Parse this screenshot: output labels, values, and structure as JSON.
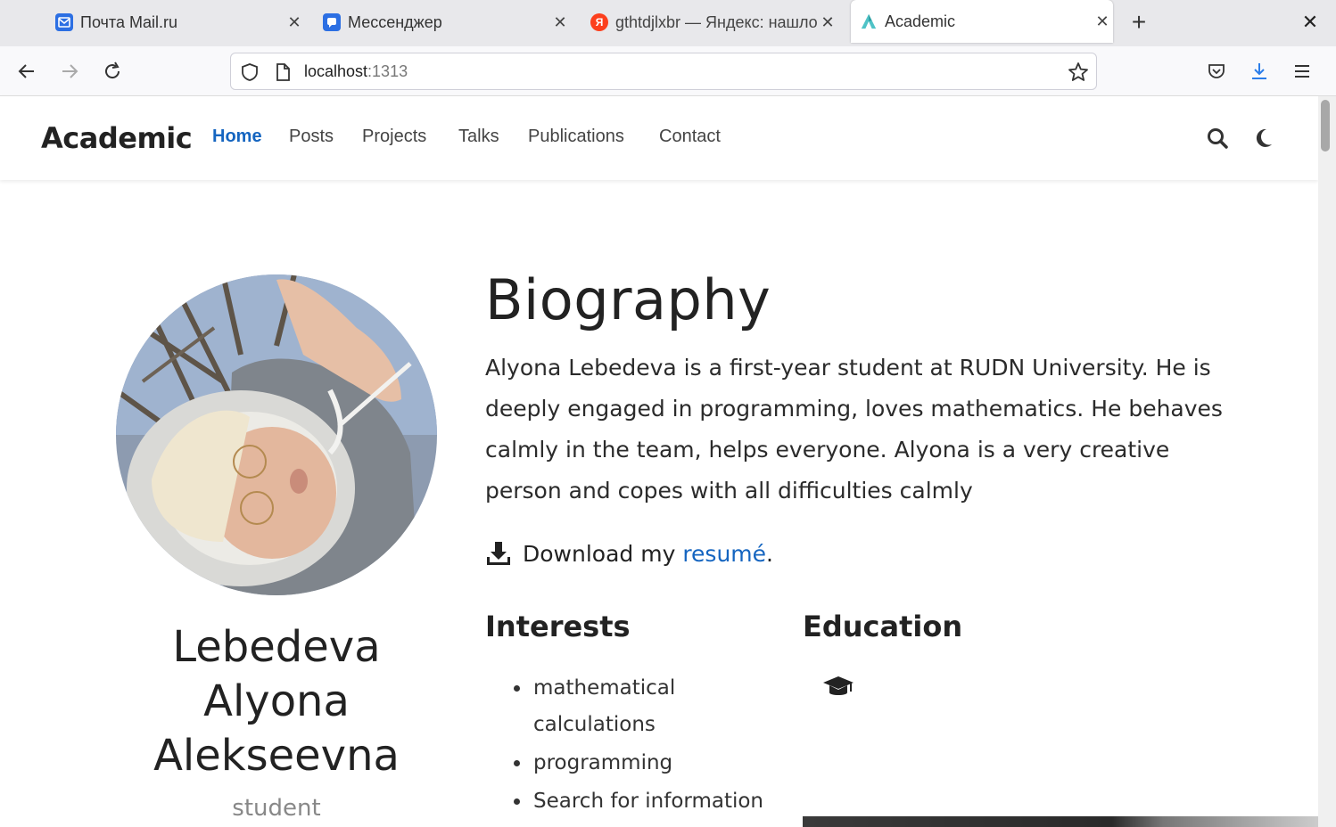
{
  "browser": {
    "tabs": [
      {
        "title": "Почта Mail.ru",
        "icon": "mail-icon",
        "color": "#2c6fe3",
        "active": false
      },
      {
        "title": "Мессенджер",
        "icon": "messenger-icon",
        "color": "#2c6fe3",
        "active": false
      },
      {
        "title": "gthtdjlxbr — Яндекс: нашлось",
        "icon": "yandex-icon",
        "color": "#fc3f1d",
        "active": false
      },
      {
        "title": "Academic",
        "icon": "academic-icon",
        "color": "#4fc3c7",
        "active": true
      }
    ],
    "url_host": "localhost",
    "url_port": ":1313"
  },
  "site": {
    "brand": "Academic",
    "menu": [
      {
        "label": "Home",
        "active": true
      },
      {
        "label": "Posts",
        "active": false
      },
      {
        "label": "Projects",
        "active": false
      },
      {
        "label": "Talks",
        "active": false
      },
      {
        "label": "Publications",
        "active": false
      },
      {
        "label": "Contact",
        "active": false
      }
    ]
  },
  "profile": {
    "name_lines": [
      "Lebedeva",
      "Alyona",
      "Alekseevna"
    ],
    "role": "student"
  },
  "biography": {
    "title": "Biography",
    "text": "Alyona Lebedeva is a first-year student at RUDN University. He is deeply engaged in programming, loves mathematics. He behaves calmly in the team, helps everyone. Alyona is a very creative person and copes with all difficulties calmly",
    "download_prefix": "Download my ",
    "download_link": "resumé",
    "download_suffix": "."
  },
  "interests": {
    "title": "Interests",
    "items": [
      "mathematical calculations",
      "programming",
      "Search for information"
    ]
  },
  "education": {
    "title": "Education",
    "icon": "graduation-cap-icon"
  },
  "colors": {
    "accent": "#1565c0"
  }
}
